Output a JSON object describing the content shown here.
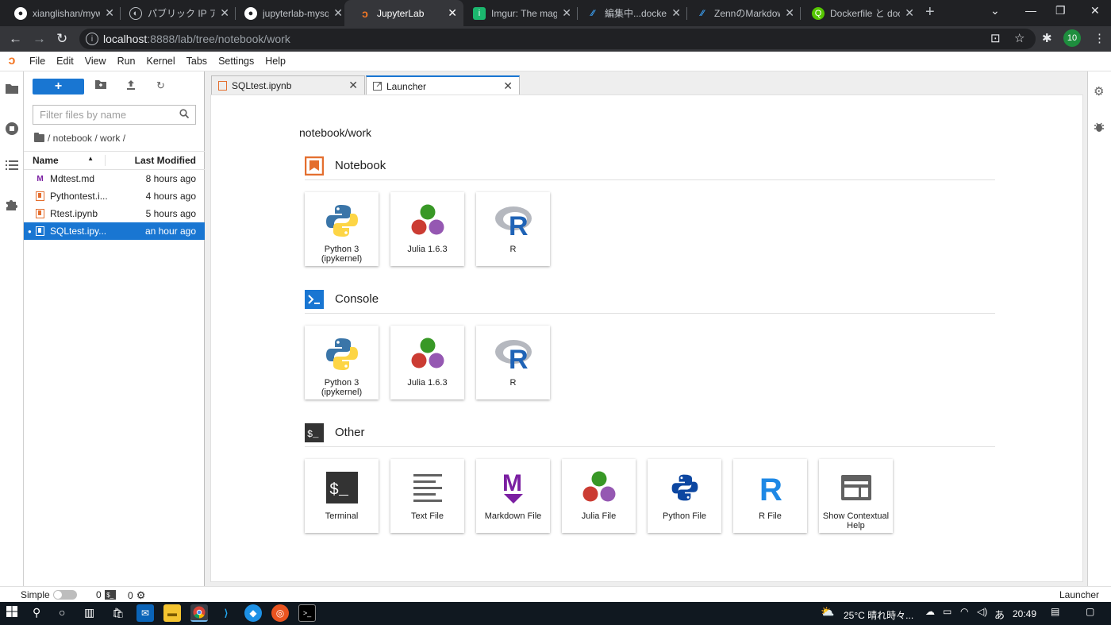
{
  "browser": {
    "tabs": [
      {
        "title": "xianglishan/mywo",
        "favicon": "github-icon"
      },
      {
        "title": "パブリック IP アドレス",
        "favicon": "globe-icon"
      },
      {
        "title": "jupyterlab-mysql",
        "favicon": "github-icon"
      },
      {
        "title": "JupyterLab",
        "favicon": "jupyter-icon",
        "active": true
      },
      {
        "title": "Imgur: The magic",
        "favicon": "imgur-icon"
      },
      {
        "title": "編集中...dockerで",
        "favicon": "zenn-icon"
      },
      {
        "title": "ZennのMarkdown",
        "favicon": "zenn-icon"
      },
      {
        "title": "Dockerfile と dock",
        "favicon": "qiita-icon"
      }
    ],
    "url_host": "localhost",
    "url_rest": ":8888/lab/tree/notebook/work",
    "profile_badge": "10"
  },
  "menu": [
    "File",
    "Edit",
    "View",
    "Run",
    "Kernel",
    "Tabs",
    "Settings",
    "Help"
  ],
  "filebrowser": {
    "new_label": "+",
    "filter_placeholder": "Filter files by name",
    "breadcrumb": "/ notebook / work /",
    "col_name": "Name",
    "col_modified": "Last Modified",
    "files": [
      {
        "name": "Mdtest.md",
        "modified": "8 hours ago",
        "type": "markdown"
      },
      {
        "name": "Pythontest.i...",
        "modified": "4 hours ago",
        "type": "notebook"
      },
      {
        "name": "Rtest.ipynb",
        "modified": "5 hours ago",
        "type": "notebook"
      },
      {
        "name": "SQLtest.ipy...",
        "modified": "an hour ago",
        "type": "notebook",
        "selected": true
      }
    ]
  },
  "doc_tabs": [
    {
      "label": "SQLtest.ipynb"
    },
    {
      "label": "Launcher",
      "active": true
    }
  ],
  "launcher": {
    "path": "notebook/work",
    "sections": [
      {
        "title": "Notebook",
        "cards": [
          "Python 3\n(ipykernel)",
          "Julia 1.6.3",
          "R"
        ]
      },
      {
        "title": "Console",
        "cards": [
          "Python 3\n(ipykernel)",
          "Julia 1.6.3",
          "R"
        ]
      },
      {
        "title": "Other",
        "cards": [
          "Terminal",
          "Text File",
          "Markdown File",
          "Julia File",
          "Python File",
          "R File",
          "Show Contextual\nHelp"
        ]
      }
    ]
  },
  "status": {
    "mode": "Simple",
    "kernels": "0",
    "terminals": "0",
    "right": "Launcher"
  },
  "taskbar": {
    "weather": "25°C  晴れ時々...",
    "ime": "あ",
    "time": "20:49"
  },
  "colors": {
    "accent": "#1976d2",
    "jupyter_orange": "#f37726",
    "notebook_icon": "#e46e2e"
  }
}
